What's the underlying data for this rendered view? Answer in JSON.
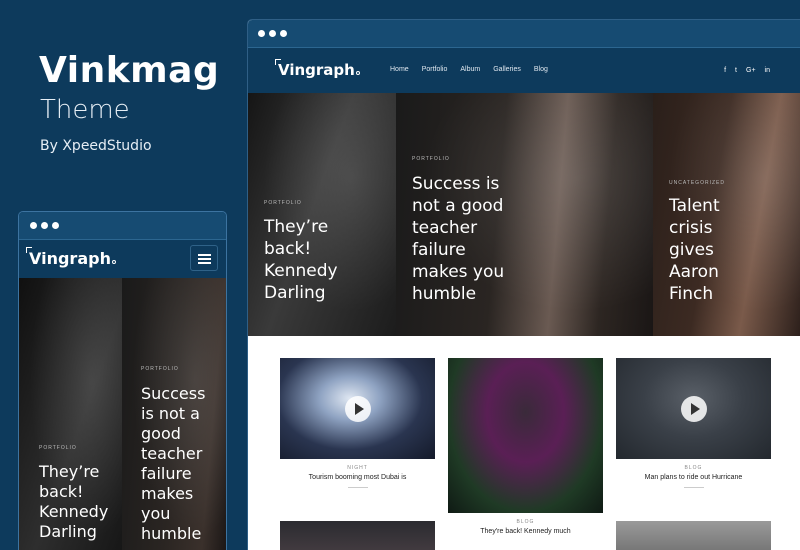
{
  "promo": {
    "title": "Vinkmag",
    "subtitle": "Theme",
    "byline": "By XpeedStudio"
  },
  "site": {
    "logo": "Vingraph",
    "menu": [
      "Home",
      "Portfolio",
      "Album",
      "Galleries",
      "Blog"
    ],
    "socials": [
      "f",
      "t",
      "G+",
      "in"
    ]
  },
  "hero": [
    {
      "category": "PORTFOLIO",
      "title": "They’re back! Kennedy Darling"
    },
    {
      "category": "PORTFOLIO",
      "title": "Success is not a good teacher failure makes you humble"
    },
    {
      "category": "UNCATEGORIZED",
      "title": "Talent crisis gives Aaron Finch"
    }
  ],
  "cards": [
    {
      "category": "NIGHT",
      "title": "Tourism booming most Dubai is"
    },
    {
      "category": "BLOG",
      "title": "They're back! Kennedy much"
    },
    {
      "category": "BLOG",
      "title": "Man plans to ride out Hurricane"
    }
  ],
  "mobile": {
    "logo": "Vingraph",
    "hero": [
      {
        "category": "PORTFOLIO",
        "title": "They’re back! Kennedy Darling"
      },
      {
        "category": "PORTFOLIO",
        "title": "Success is not a good teacher failure makes you humble"
      }
    ]
  }
}
